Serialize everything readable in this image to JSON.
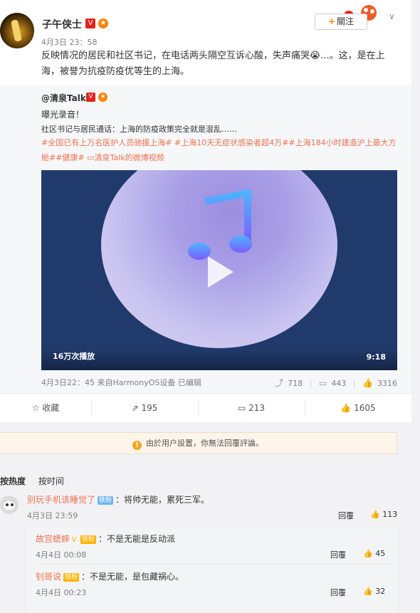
{
  "post": {
    "username": "子午侠士",
    "time": "4月3日 23：58",
    "text": "反映情况的居民和社区书记，在电话两头隔空互诉心酸，失声痛哭😭...。这，是在上海，被誉为抗疫防疫优等生的上海。",
    "follow_label": "關注"
  },
  "repost": {
    "username": "@清泉Talk",
    "line1": "曝光录音！",
    "line2": "社区书记与居民通话：上海的防疫政策完全就是混乱……",
    "tags": "#全国已有上万名医护人员驰援上海# #上海10天无症状感染者超4万##上海184小时建造沪上最大方舱##健康#",
    "video_link": "清泉Talk的微博视频",
    "video": {
      "views": "16万次播放",
      "duration": "9:18"
    },
    "meta": "4月3日22：45 来自HarmonyOS设备  已编辑",
    "reposts": "718",
    "comments": "443",
    "likes": "3316"
  },
  "actions": {
    "favorite": "收藏",
    "repost": "195",
    "comment": "213",
    "like": "1605"
  },
  "notice": "由於用户設置，你無法回覆評論。",
  "sort": {
    "hot": "按热度",
    "time": "按时间"
  },
  "comment": {
    "name": "别玩手机该睡觉了",
    "fan": "铁粉",
    "text": "：将帅无能，累死三军。",
    "time": "4月3日 23:59",
    "reply": "回覆",
    "likes": "113"
  },
  "replies": [
    {
      "name": "故宫蟋蟀",
      "fan": "铁粉",
      "text": "：不是无能是反动派",
      "time": "4月4日 00:08",
      "reply": "回覆",
      "likes": "45"
    },
    {
      "name": "钊哥说",
      "fan": "铁粉",
      "text": "：不是无能，是包藏祸心。",
      "time": "4月4日 00:23",
      "reply": "回覆",
      "likes": "32"
    }
  ],
  "icons": {
    "verified": "verified-v-icon",
    "member": "member-crown-icon",
    "chevron": "chevron-down-icon",
    "favorite": "star-icon",
    "repost": "repost-icon",
    "comment": "comment-icon",
    "like": "thumb-up-icon",
    "warning": "warning-icon",
    "play": "play-icon"
  },
  "colors": {
    "accent": "#ff8200",
    "link": "#eb7350",
    "verified": "#e2231a"
  }
}
